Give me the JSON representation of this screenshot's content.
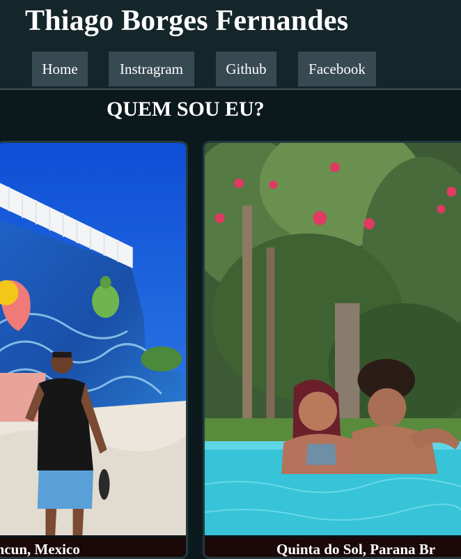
{
  "header": {
    "title": "Thiago Borges Fernandes",
    "nav": [
      {
        "label": "Home"
      },
      {
        "label": "Instragram"
      },
      {
        "label": "Github"
      },
      {
        "label": "Facebook"
      }
    ]
  },
  "section": {
    "title": "QUEM SOU EU?"
  },
  "gallery": [
    {
      "caption": "Cancun, Mexico",
      "photo_icon": "beach-mural-photo"
    },
    {
      "caption": "Quinta do Sol, Parana Br",
      "photo_icon": "pool-couple-photo"
    }
  ],
  "colors": {
    "header_bg": "#15262b",
    "nav_button_bg": "#374a51",
    "page_bg": "#0c1a1e",
    "caption_bg": "#1a0908"
  }
}
